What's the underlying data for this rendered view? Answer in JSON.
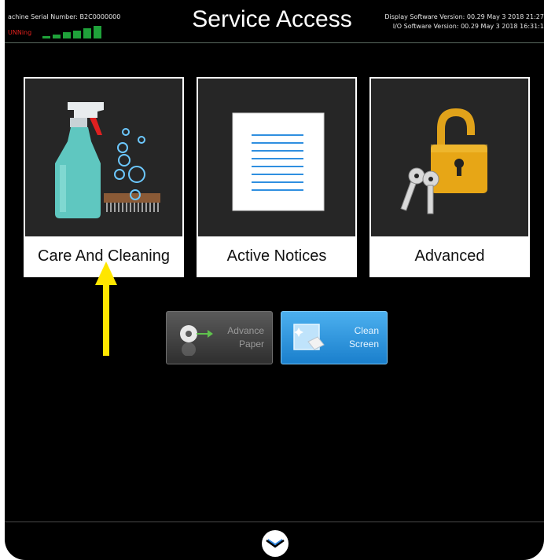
{
  "header": {
    "serial": "achine Serial Number: B2C0000000",
    "status": "UNNing",
    "title": "Service Access",
    "display_version": "Display Software Version: 00.29 May  3 2018 21:27",
    "io_version": "I/O Software Version: 00.29 May  3 2018 16:31:1"
  },
  "tiles": [
    {
      "label": "Care And Cleaning",
      "icon": "spray-bottle-brush-icon"
    },
    {
      "label": "Active Notices",
      "icon": "document-icon"
    },
    {
      "label": "Advanced",
      "icon": "padlock-keys-icon"
    }
  ],
  "buttons": {
    "advance_paper": {
      "line1": "Advance",
      "line2": "Paper",
      "icon": "paper-roll-icon",
      "state": "disabled"
    },
    "clean_screen": {
      "line1": "Clean",
      "line2": "Screen",
      "icon": "cloth-wipe-icon"
    }
  },
  "footer": {
    "icon": "chevron-down-icon"
  },
  "colors": {
    "background": "#000000",
    "status_red": "#e0201d",
    "signal_green": "#1fa23a",
    "accent_blue": "#2b96e0",
    "arrow_yellow": "#ffe600",
    "lock_gold": "#e0a21a"
  }
}
